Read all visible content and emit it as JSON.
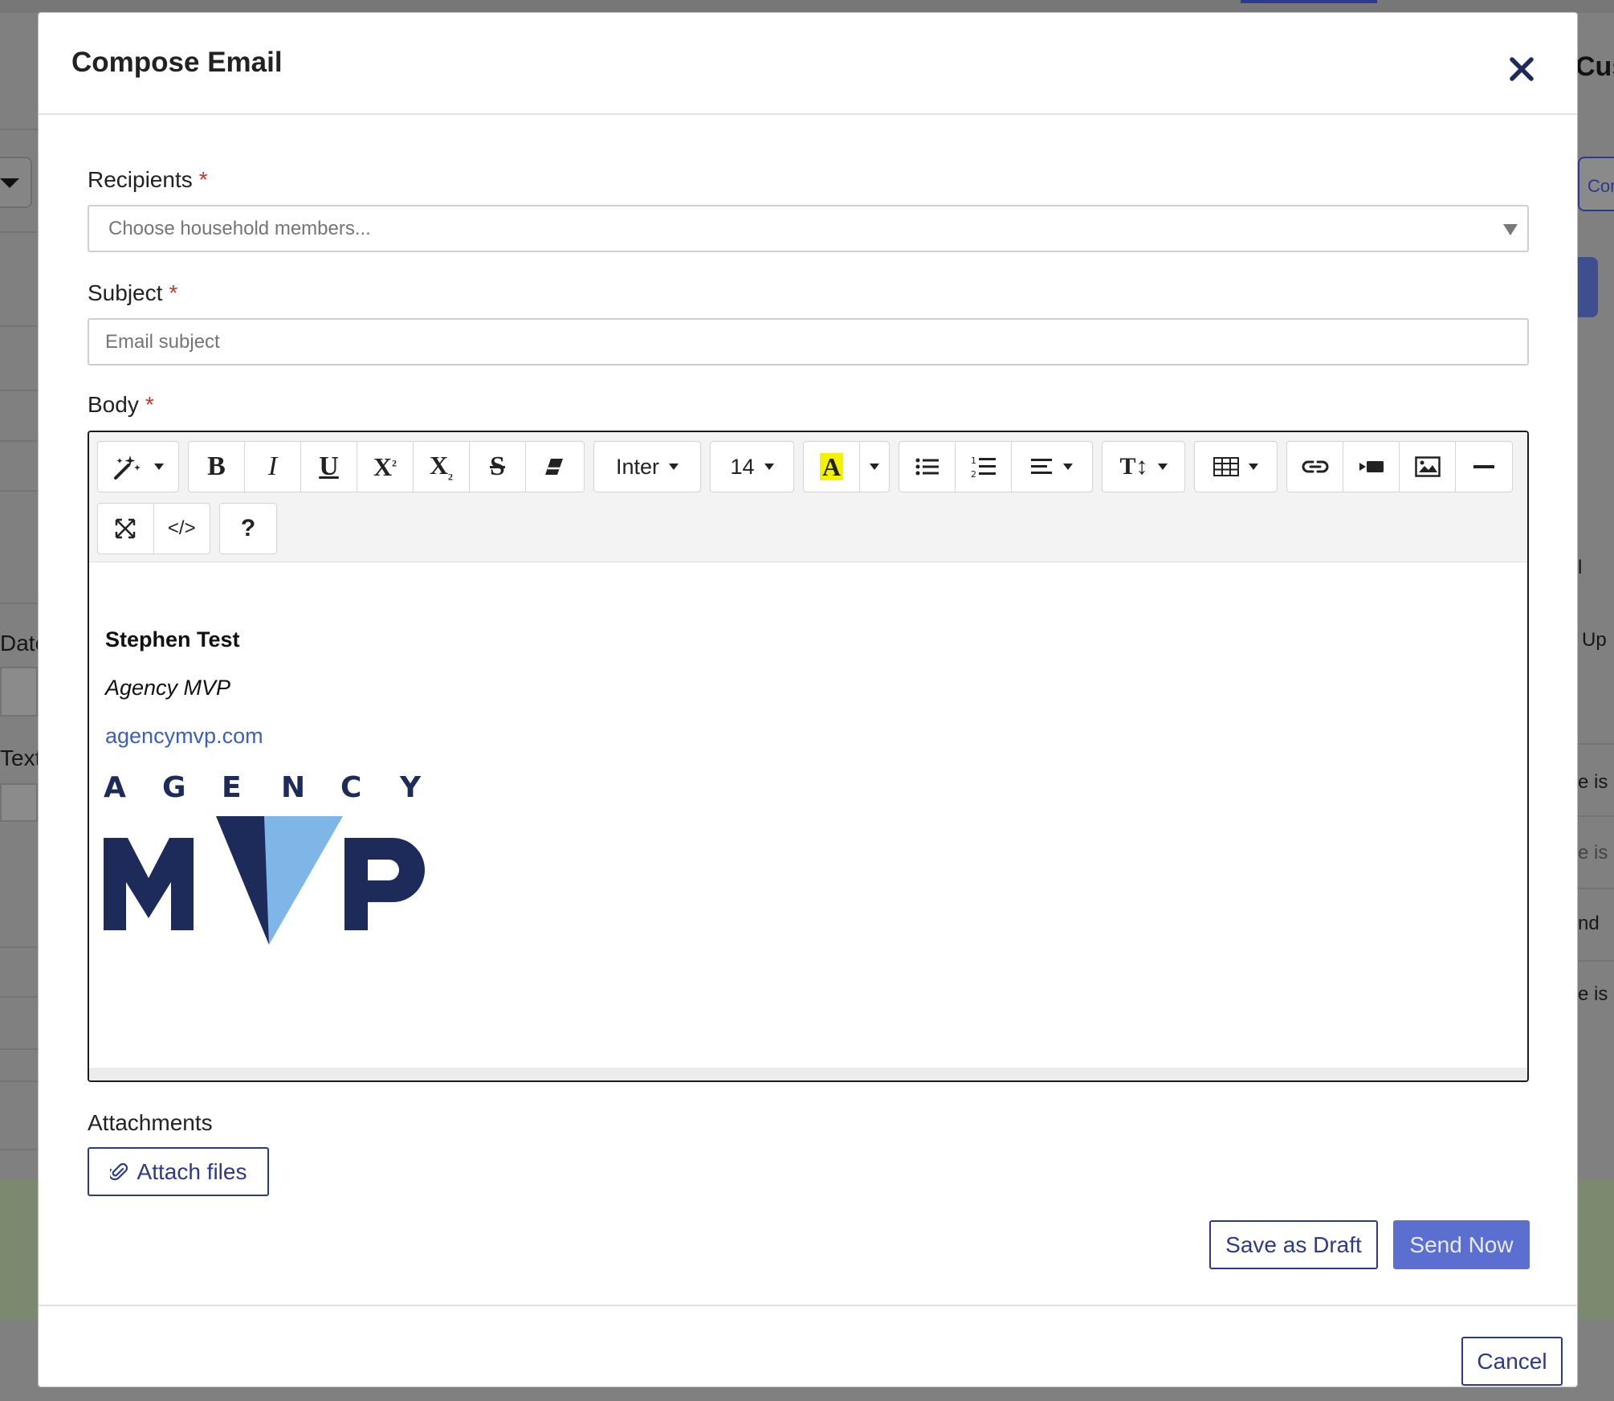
{
  "modal": {
    "title": "Compose Email",
    "close_icon": "close-icon"
  },
  "recipients": {
    "label": "Recipients",
    "required_mark": "*",
    "placeholder": "Choose household members..."
  },
  "subject": {
    "label": "Subject",
    "required_mark": "*",
    "placeholder": "Email subject",
    "value": ""
  },
  "body": {
    "label": "Body",
    "required_mark": "*",
    "toolbar": {
      "font_family": "Inter",
      "font_size": "14",
      "code_view_label": "</>",
      "help_label": "?",
      "highlight_color": "#f5f200",
      "icons": [
        "magic-icon",
        "bold-icon",
        "italic-icon",
        "underline-icon",
        "superscript-icon",
        "subscript-icon",
        "strikethrough-icon",
        "eraser-icon",
        "highlight-icon",
        "bullet-list-icon",
        "numbered-list-icon",
        "align-icon",
        "line-height-icon",
        "table-icon",
        "link-icon",
        "video-icon",
        "image-icon",
        "horizontal-rule-icon",
        "fullscreen-icon",
        "code-view-icon",
        "help-icon"
      ]
    },
    "signature": {
      "name": "Stephen Test",
      "company": "Agency MVP",
      "link_text": "agencymvp.com",
      "logo_top_text": "AGENCY",
      "logo_main_text": "MVP"
    }
  },
  "attachments": {
    "label": "Attachments",
    "button_label": "Attach files"
  },
  "actions": {
    "save_draft_label": "Save as Draft",
    "send_now_label": "Send Now",
    "cancel_label": "Cancel"
  },
  "background": {
    "right_title": "Cus",
    "right_button": "Con",
    "left_labels": [
      "Date",
      "Text"
    ],
    "right_labels": [
      "l",
      "Up",
      "e is",
      "e is",
      "nd",
      "e is"
    ]
  },
  "colors": {
    "primary": "#2b3a8c",
    "primary_filled": "#5b6fd0",
    "required": "#c0392b",
    "link": "#3b5fc0",
    "logo_dark": "#1c2b5a",
    "logo_light": "#7fb6e8"
  }
}
